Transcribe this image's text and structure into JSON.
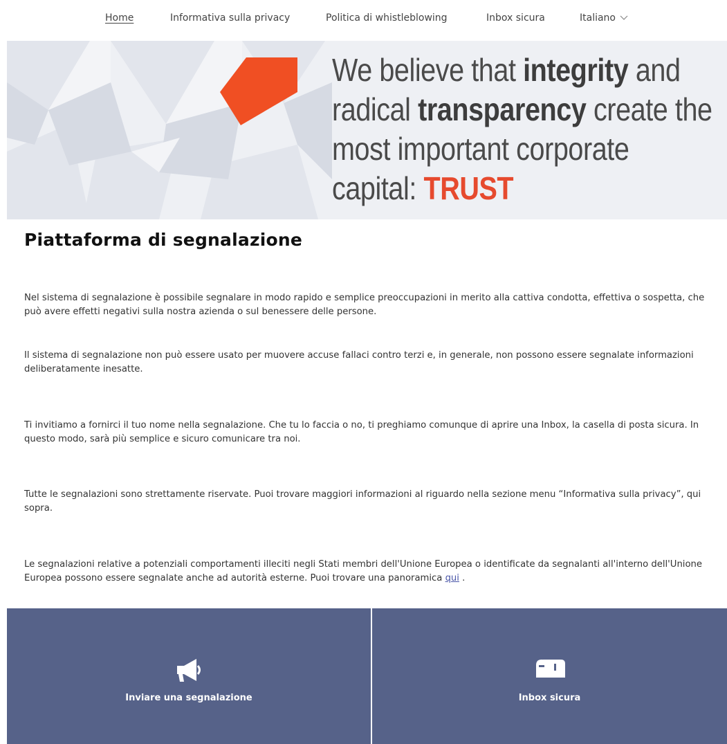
{
  "nav": {
    "items": [
      {
        "label": "Home",
        "active": true
      },
      {
        "label": "Informativa sulla privacy",
        "active": false
      },
      {
        "label": "Politica di whistleblowing",
        "active": false
      },
      {
        "label": "Inbox sicura",
        "active": false
      }
    ],
    "language": "Italiano"
  },
  "hero": {
    "line1_pre": "We believe that ",
    "line1_bold": "integrity",
    "line1_post": " and",
    "line2_pre": "radical ",
    "line2_bold": "transparency",
    "line2_post": " create the",
    "line3": "most important corporate",
    "line4_pre": "capital: ",
    "line4_bold": "TRUST",
    "accent_color": "#e64a2e"
  },
  "main": {
    "title": "Piattaforma di segnalazione",
    "paragraphs": [
      "Nel sistema di segnalazione è possibile segnalare in modo rapido e semplice preoccupazioni in merito alla cattiva condotta, effettiva o sospetta, che può avere effetti negativi sulla nostra azienda o sul benessere delle persone.",
      "Il sistema di segnalazione non può essere usato per muovere accuse fallaci contro terzi e, in generale, non possono essere segnalate informazioni deliberatamente inesatte.",
      "Ti invitiamo a fornirci il tuo nome nella segnalazione. Che tu lo faccia o no, ti preghiamo comunque di aprire una Inbox, la casella di posta sicura. In questo modo, sarà più semplice e sicuro comunicare tra noi.",
      "Tutte le segnalazioni sono strettamente riservate. Puoi trovare maggiori informazioni al riguardo nella sezione menu “Informativa sulla privacy”, qui sopra."
    ],
    "last_paragraph_text": "Le segnalazioni relative a potenziali comportamenti illeciti negli Stati membri dell'Unione Europea o identificate da segnalanti all'interno dell'Unione Europea possono essere segnalate anche ad autorità esterne. Puoi trovare una panoramica ",
    "last_paragraph_link": "qui",
    "last_paragraph_end": " ."
  },
  "tiles": {
    "report": {
      "label": "Inviare una segnalazione",
      "icon": "megaphone-icon"
    },
    "inbox": {
      "label": "Inbox sicura",
      "icon": "mailbox-icon"
    },
    "color": "#566289"
  }
}
